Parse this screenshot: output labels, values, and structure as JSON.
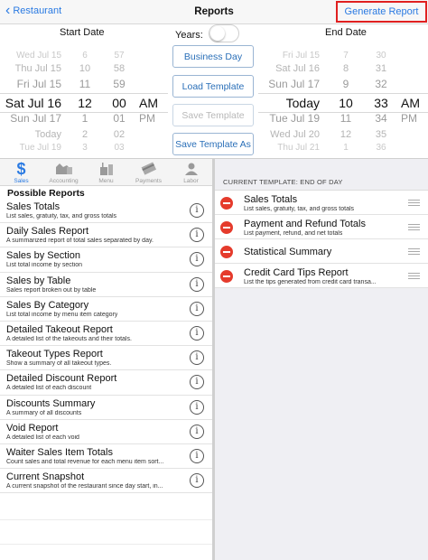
{
  "nav": {
    "back_label": "Restaurant",
    "title": "Reports",
    "generate_label": "Generate Report",
    "accent": "#2a7ae2",
    "highlight": "#e02020"
  },
  "dates": {
    "start_label": "Start Date",
    "end_label": "End Date",
    "years_label": "Years:",
    "years_on": false
  },
  "start_picker": {
    "rows": [
      {
        "day": "Wed Jul 15",
        "hour": "6",
        "min": "57",
        "ampm": ""
      },
      {
        "day": "Thu Jul 15",
        "hour": "10",
        "min": "58",
        "ampm": ""
      },
      {
        "day": "Fri Jul 15",
        "hour": "11",
        "min": "59",
        "ampm": ""
      },
      {
        "day": "Sat Jul 16",
        "hour": "12",
        "min": "00",
        "ampm": "AM"
      },
      {
        "day": "Sun Jul 17",
        "hour": "1",
        "min": "01",
        "ampm": "PM"
      },
      {
        "day": "Today",
        "hour": "2",
        "min": "02",
        "ampm": ""
      },
      {
        "day": "Tue Jul 19",
        "hour": "3",
        "min": "03",
        "ampm": ""
      }
    ]
  },
  "end_picker": {
    "rows": [
      {
        "day": "Fri Jul 15",
        "hour": "7",
        "min": "30",
        "ampm": ""
      },
      {
        "day": "Sat Jul 16",
        "hour": "8",
        "min": "31",
        "ampm": ""
      },
      {
        "day": "Sun Jul 17",
        "hour": "9",
        "min": "32",
        "ampm": ""
      },
      {
        "day": "Today",
        "hour": "10",
        "min": "33",
        "ampm": "AM"
      },
      {
        "day": "Tue Jul 19",
        "hour": "11",
        "min": "34",
        "ampm": "PM"
      },
      {
        "day": "Wed Jul 20",
        "hour": "12",
        "min": "35",
        "ampm": ""
      },
      {
        "day": "Thu Jul 21",
        "hour": "1",
        "min": "36",
        "ampm": ""
      }
    ]
  },
  "template_buttons": {
    "business_day": "Business Day",
    "load_template": "Load Template",
    "save_template": "Save Template",
    "save_template_as": "Save Template As"
  },
  "tabs": [
    {
      "label": "Sales",
      "icon": "dollar-icon",
      "active": true
    },
    {
      "label": "Accounting",
      "icon": "accounting-icon",
      "active": false
    },
    {
      "label": "Menu",
      "icon": "menu-icon",
      "active": false
    },
    {
      "label": "Payments",
      "icon": "payments-icon",
      "active": false
    },
    {
      "label": "Labor",
      "icon": "labor-icon",
      "active": false
    }
  ],
  "possible_reports": {
    "title": "Possible Reports",
    "items": [
      {
        "title": "Sales Totals",
        "desc": "List sales, gratuity, tax, and gross totals"
      },
      {
        "title": "Daily Sales Report",
        "desc": "A summarized report of total sales separated by day."
      },
      {
        "title": "Sales by Section",
        "desc": "List total income by section"
      },
      {
        "title": "Sales by Table",
        "desc": "Sales report broken out by table"
      },
      {
        "title": "Sales By Category",
        "desc": "List total income by menu item category"
      },
      {
        "title": "Detailed Takeout Report",
        "desc": "A detailed list of the takeouts and their totals."
      },
      {
        "title": "Takeout Types Report",
        "desc": "Show a summary of all takeout types."
      },
      {
        "title": "Detailed Discount Report",
        "desc": "A detailed list of each discount"
      },
      {
        "title": "Discounts Summary",
        "desc": "A summary of all discounts"
      },
      {
        "title": "Void Report",
        "desc": "A detailed list of each void"
      },
      {
        "title": "Waiter Sales Item Totals",
        "desc": "Count sales and total revenue for each menu item sort..."
      },
      {
        "title": "Current Snapshot",
        "desc": "A current snapshot of the restaurant since day start, in..."
      }
    ]
  },
  "current_template": {
    "label": "CURRENT TEMPLATE: END OF DAY",
    "items": [
      {
        "title": "Sales Totals",
        "desc": "List sales, gratuity, tax, and gross totals"
      },
      {
        "title": "Payment and Refund Totals",
        "desc": "List payment, refund, and net totals"
      },
      {
        "title": "Statistical Summary",
        "desc": ""
      },
      {
        "title": "Credit Card Tips Report",
        "desc": "List the tips generated from credit card transa..."
      }
    ]
  }
}
